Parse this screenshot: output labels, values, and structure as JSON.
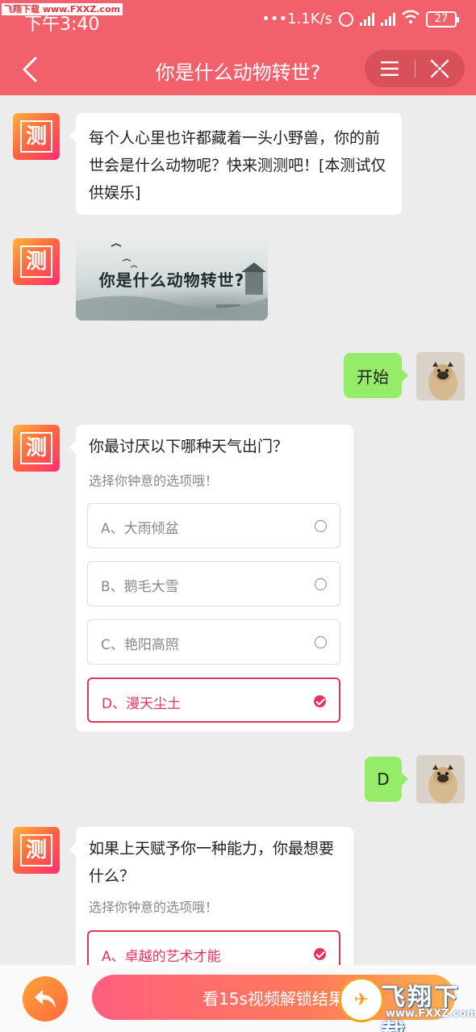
{
  "watermark": {
    "top_left": "飞翔下载 www.FXXZ.com",
    "logo_text": "飞翔下载",
    "logo_url": "www.FXXZ.com"
  },
  "status_bar": {
    "time": "下午3:40",
    "speed": "•••1.1K/s",
    "battery": "27"
  },
  "header": {
    "title": "你是什么动物转世?",
    "back_icon": "chevron-left-icon",
    "menu_icon": "menu-icon",
    "close_icon": "close-target-icon",
    "bg_color": "#f2606b"
  },
  "bot": {
    "avatar_glyph": "测"
  },
  "messages": {
    "intro": "每个人心里也许都藏着一头小野兽，你的前世会是什么动物呢？快来测测吧！[本测试仅供娱乐]",
    "image_title": "你是什么动物转世?",
    "user_start": "开始",
    "user_answer1": "D"
  },
  "question1": {
    "text": "你最讨厌以下哪种天气出门？",
    "hint": "选择你钟意的选项哦！",
    "options": [
      {
        "label": "A、大雨倾盆",
        "selected": false
      },
      {
        "label": "B、鹅毛大雪",
        "selected": false
      },
      {
        "label": "C、艳阳高照",
        "selected": false
      },
      {
        "label": "D、漫天尘土",
        "selected": true
      }
    ]
  },
  "question2": {
    "text": "如果上天赋予你一种能力，你最想要什么？",
    "hint": "选择你钟意的选项哦！",
    "options": [
      {
        "label": "A、卓越的艺术才能",
        "selected": true
      }
    ]
  },
  "bottom": {
    "unlock_label": "看15s视频解锁结果",
    "reply_icon": "reply-arrow-icon"
  },
  "colors": {
    "accent": "#e5335a",
    "user_bubble": "#95ec69"
  }
}
